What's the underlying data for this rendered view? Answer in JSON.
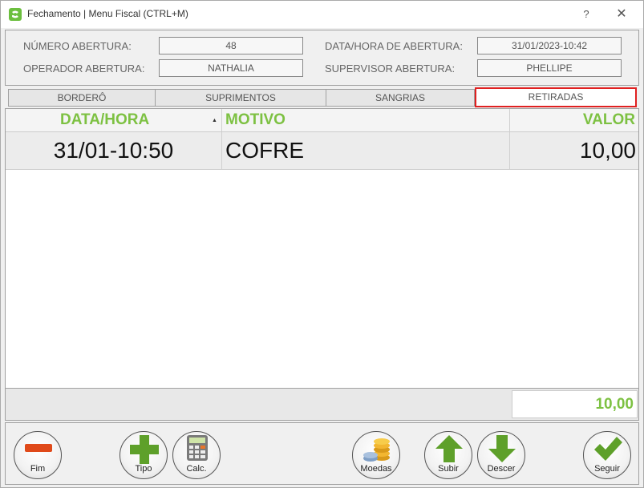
{
  "window": {
    "title": "Fechamento | Menu Fiscal (CTRL+M)",
    "help": "?",
    "close": "✕"
  },
  "info": {
    "numero_abertura_label": "NÚMERO ABERTURA:",
    "numero_abertura_value": "48",
    "data_hora_label": "DATA/HORA DE ABERTURA:",
    "data_hora_value": "31/01/2023-10:42",
    "operador_label": "OPERADOR ABERTURA:",
    "operador_value": "NATHALIA",
    "supervisor_label": "SUPERVISOR ABERTURA:",
    "supervisor_value": "PHELLIPE"
  },
  "tabs": [
    {
      "label": "BORDERÔ",
      "active": false
    },
    {
      "label": "SUPRIMENTOS",
      "active": false
    },
    {
      "label": "SANGRIAS",
      "active": false
    },
    {
      "label": "RETIRADAS",
      "active": true
    }
  ],
  "grid": {
    "columns": [
      "DATA/HORA",
      "MOTIVO",
      "VALOR"
    ],
    "sort_indicator": "▲",
    "rows": [
      {
        "data_hora": "31/01-10:50",
        "motivo": "COFRE",
        "valor": "10,00"
      }
    ]
  },
  "total": "10,00",
  "toolbar": {
    "fim": "Fim",
    "tipo": "Tipo",
    "calc": "Calc.",
    "moedas": "Moedas",
    "subir": "Subir",
    "descer": "Descer",
    "seguir": "Seguir"
  },
  "colors": {
    "accent_green": "#7dc142",
    "active_tab_border": "#e02020",
    "minus_red": "#e04a1a"
  }
}
